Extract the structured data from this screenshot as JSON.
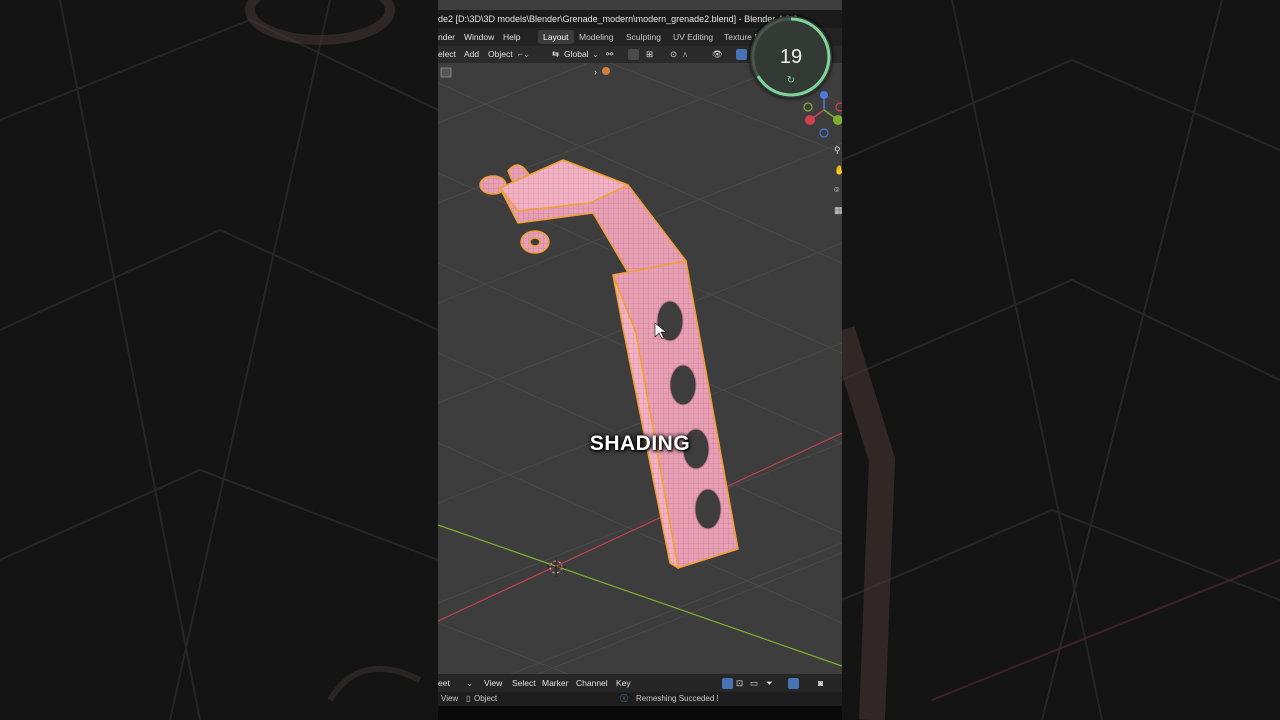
{
  "window": {
    "title": "de2 [D:\\3D\\3D models\\Blender\\Grenade_modern\\modern_grenade2.blend] - Blender 4.3.2"
  },
  "menu": {
    "items": [
      "nder",
      "Window",
      "Help"
    ],
    "workspaces": [
      "Layout",
      "Modeling",
      "Sculpting",
      "UV Editing",
      "Texture P"
    ],
    "active_workspace": "Layout"
  },
  "viewport_header": {
    "select": "elect",
    "add": "Add",
    "object": "Object",
    "orientation": "Global"
  },
  "overlay": {
    "caption": "SHADING",
    "timer_value": "19",
    "timer_icon": "refresh-icon"
  },
  "timeline": {
    "editor": "eet",
    "items": [
      "View",
      "Select",
      "Marker",
      "Channel",
      "Key"
    ]
  },
  "statusbar": {
    "view": "View",
    "object": "Object",
    "message": "Remeshing Succeded !"
  },
  "colors": {
    "mesh_fill": "#e9a0b4",
    "mesh_outline": "#f0a030",
    "viewport_bg": "#3d3d3d",
    "x_axis": "#c04050",
    "y_axis": "#7fb030",
    "timer_ring": "#7fd39a",
    "accent": "#4772b3"
  }
}
